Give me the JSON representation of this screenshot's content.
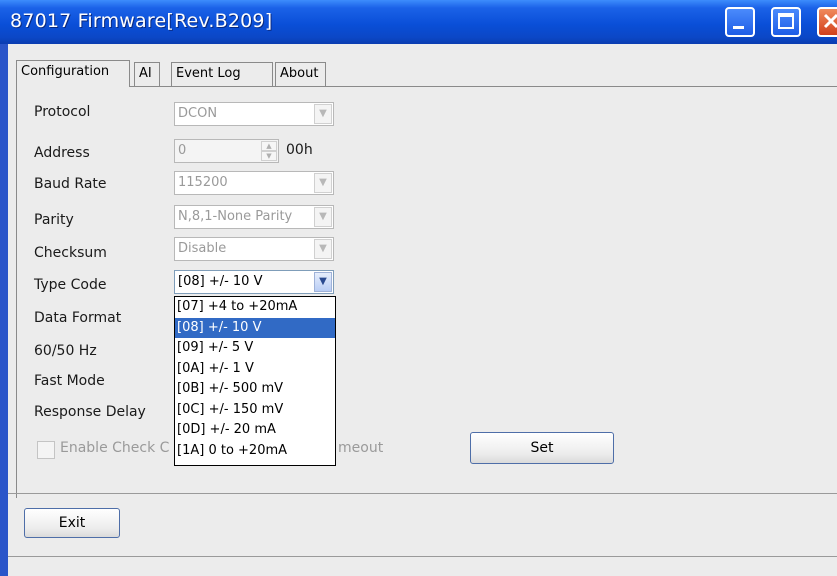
{
  "window": {
    "title": "87017 Firmware[Rev.B209]"
  },
  "tabs": [
    {
      "label": "Configuration"
    },
    {
      "label": "AI"
    },
    {
      "label": "Event Log"
    },
    {
      "label": "About"
    }
  ],
  "form": {
    "protocol": {
      "label": "Protocol",
      "value": "DCON"
    },
    "address": {
      "label": "Address",
      "value": "0",
      "suffix": "00h"
    },
    "baud_rate": {
      "label": "Baud Rate",
      "value": "115200"
    },
    "parity": {
      "label": "Parity",
      "value": "N,8,1-None Parity"
    },
    "checksum": {
      "label": "Checksum",
      "value": "Disable"
    },
    "type_code": {
      "label": "Type Code",
      "value": "[08] +/- 10 V"
    },
    "data_format": {
      "label": "Data Format"
    },
    "hz": {
      "label": "60/50 Hz"
    },
    "fast_mode": {
      "label": "Fast Mode"
    },
    "response_delay": {
      "label": "Response Delay"
    },
    "enable_check": {
      "label_left": "Enable Check C",
      "label_right": "meout"
    }
  },
  "type_code_options": [
    "[07] +4 to +20mA",
    "[08] +/- 10 V",
    "[09] +/- 5 V",
    "[0A] +/- 1 V",
    "[0B] +/- 500 mV",
    "[0C] +/- 150 mV",
    "[0D] +/- 20 mA",
    "[1A] 0 to +20mA"
  ],
  "selected_option": "[08] +/- 10 V",
  "buttons": {
    "set": "Set",
    "exit": "Exit"
  },
  "colors": {
    "titlebar": "#0a4fd8",
    "selection": "#316ac5",
    "face": "#ececec"
  }
}
